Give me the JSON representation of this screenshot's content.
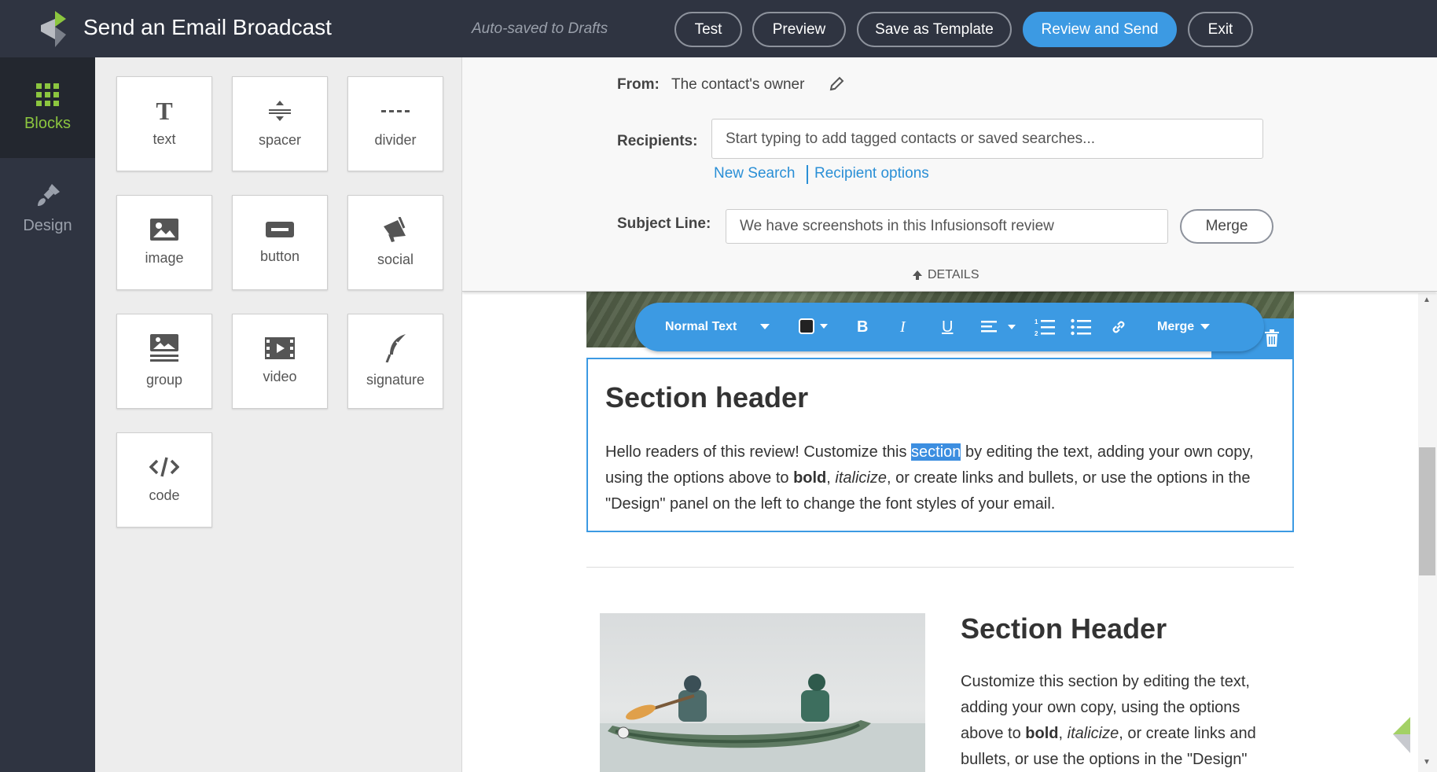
{
  "header": {
    "title": "Send an Email Broadcast",
    "autosave": "Auto-saved to Drafts",
    "buttons": {
      "test": "Test",
      "preview": "Preview",
      "save_template": "Save as Template",
      "review_send": "Review and Send",
      "exit": "Exit"
    }
  },
  "nav": {
    "blocks": "Blocks",
    "design": "Design"
  },
  "blocks": [
    {
      "label": "text",
      "icon": "text-icon"
    },
    {
      "label": "spacer",
      "icon": "spacer-icon"
    },
    {
      "label": "divider",
      "icon": "divider-icon"
    },
    {
      "label": "image",
      "icon": "image-icon"
    },
    {
      "label": "button",
      "icon": "button-icon"
    },
    {
      "label": "social",
      "icon": "megaphone-icon"
    },
    {
      "label": "group",
      "icon": "group-icon"
    },
    {
      "label": "video",
      "icon": "video-icon"
    },
    {
      "label": "signature",
      "icon": "quill-icon"
    },
    {
      "label": "code",
      "icon": "code-icon"
    }
  ],
  "details": {
    "from_label": "From:",
    "from_value": "The contact's owner",
    "recipients_label": "Recipients:",
    "recipients_placeholder": "Start typing to add tagged contacts or saved searches...",
    "new_search": "New Search",
    "recipient_options": "Recipient options",
    "subject_label": "Subject Line:",
    "subject_value": "We have screenshots in this Infusionsoft review",
    "merge": "Merge",
    "toggle": "DETAILS"
  },
  "toolbar": {
    "style": "Normal Text",
    "merge": "Merge"
  },
  "email": {
    "section1": {
      "header": "Section header",
      "p_before": "Hello readers of this review! Customize this ",
      "p_highlight": "section",
      "p_mid": " by editing the text, adding your own copy, using the options above to ",
      "p_bold": "bold",
      "p_comma": ", ",
      "p_italic": "italicize",
      "p_after": ", or create links and bullets, or use the options in the \"Design\" panel on the left to change the font styles of your email."
    },
    "section2": {
      "header": "Section Header",
      "p_before": "Customize this section by editing the text, adding your own copy, using the options above to ",
      "p_bold": "bold",
      "p_comma": ", ",
      "p_italic": "italicize",
      "p_after": ", or create links and bullets, or use the options in the \"Design\""
    }
  },
  "colors": {
    "topbar": "#2f3441",
    "accent_blue": "#3c9ae3",
    "brand_green": "#8cc63f"
  }
}
